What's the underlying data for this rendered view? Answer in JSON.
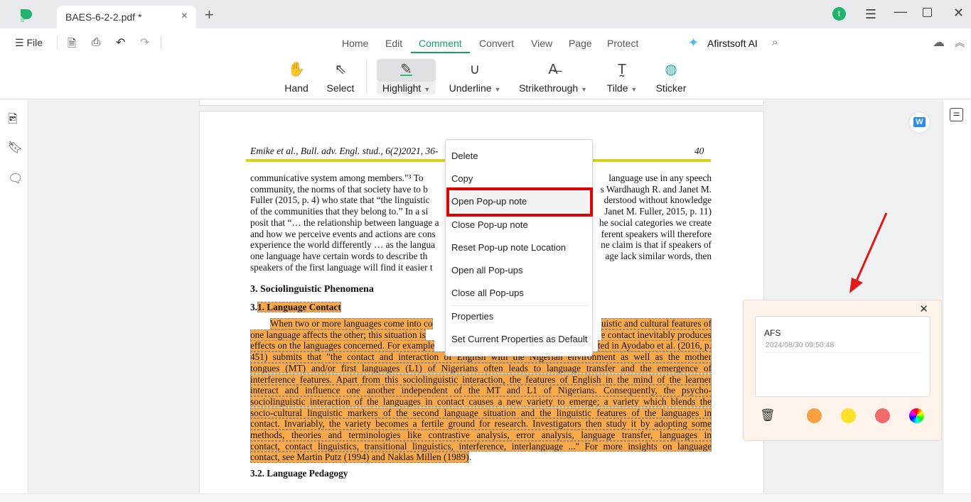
{
  "tab": {
    "title": "BAES-6-2-2.pdf *",
    "avatar_letter": "t"
  },
  "toolbar": {
    "file": "File"
  },
  "nav": [
    "Home",
    "Edit",
    "Comment",
    "Convert",
    "View",
    "Page",
    "Protect"
  ],
  "ai_label": "Afirstsoft AI",
  "tools": [
    {
      "label": "Hand"
    },
    {
      "label": "Select"
    },
    {
      "label": "Highlight"
    },
    {
      "label": "Underline"
    },
    {
      "label": "Strikethrough"
    },
    {
      "label": "Tilde"
    },
    {
      "label": "Sticker"
    }
  ],
  "document": {
    "running_head": "Emike et al., Bull. adv. Engl. stud., 6(2)2021, 36-",
    "page_number": "40",
    "para1": [
      [
        "communicative system among members.\"³ To",
        "language use in any speech"
      ],
      [
        "community, the norms of that society have to b",
        "s Wardhaugh R. and Janet M."
      ],
      [
        "Fuller (2015, p. 4) who state that “the linguistic",
        "derstood without knowledge"
      ],
      [
        "of the communities that they belong to.” In a si",
        "Janet M. Fuller, 2015, p. 11)"
      ],
      [
        "posit that “… the relationship between language a",
        "he social categories we create"
      ],
      [
        "and how we perceive events and actions are cons",
        "ferent speakers will therefore"
      ],
      [
        "experience the world differently … as the langua",
        "ne claim is that if speakers of"
      ],
      [
        "one language have certain words to describe th",
        "age lack similar words, then"
      ],
      [
        "speakers of the first language will find it easier t",
        ""
      ]
    ],
    "heading3": "3.  Sociolinguistic Phenomena",
    "heading31_num": "3.",
    "heading31": "1. Language Contact",
    "para2": [
      [
        "When two or more languages come into co",
        "uistic and cultural features of"
      ],
      [
        "one language affects the other; this situation is",
        "e contact inevitably produces"
      ],
      [
        "effects on the languages concerned. For example",
        "ted in Ayodabo et al. (2016, p."
      ],
      [
        "451) submits that \"the contact and interaction of English with the Nigerian environment as well as the mother",
        ""
      ],
      [
        "tongues (MT) and/or first languages (L1) of Nigerians often leads to language transfer and the emergence of",
        ""
      ],
      [
        "interference features. Apart from this sociolinguistic interaction, the features of English in the mind of the learner",
        ""
      ],
      [
        "interact and influence one another independent of the MT and L1 of Nigerians. Consequently, the psycho-",
        ""
      ],
      [
        "sociolinguistic interaction of the languages in contact causes a new variety to emerge; a variety which blends the",
        ""
      ],
      [
        "socio-cultural linguistic markers of the second language situation and the linguistic features of the languages in",
        ""
      ],
      [
        "contact. Invariably, the variety becomes a fertile ground for research. Investigators then study it by adopting some",
        ""
      ],
      [
        "methods, theories and terminologies like contrastive analysis, error analysis, language transfer, languages in",
        ""
      ],
      [
        "contact, contact linguistics, transitional linguistics, interference, interlanguage ...\" For more insights on language",
        ""
      ],
      [
        "contact, see Martin Putz (1994) and Naklas Millen (1989)",
        ""
      ]
    ],
    "para2_end": ".",
    "heading32": "3.2. Language Pedagogy"
  },
  "context_menu": [
    "Delete",
    "Copy",
    "Open Pop-up note",
    "Close Pop-up note",
    "Reset Pop-up note Location",
    "Open all Pop-ups",
    "Close all Pop-ups",
    "Properties",
    "Set Current Properties as Default"
  ],
  "note": {
    "author": "AFS",
    "timestamp": "2024/08/30 09:50:48",
    "colors": [
      "#f9a03f",
      "#fde02a",
      "#f26a6a"
    ]
  },
  "colors": {
    "accent": "#15a06a",
    "highlight": "#f9a94a",
    "annotation_box": "#e00000"
  }
}
